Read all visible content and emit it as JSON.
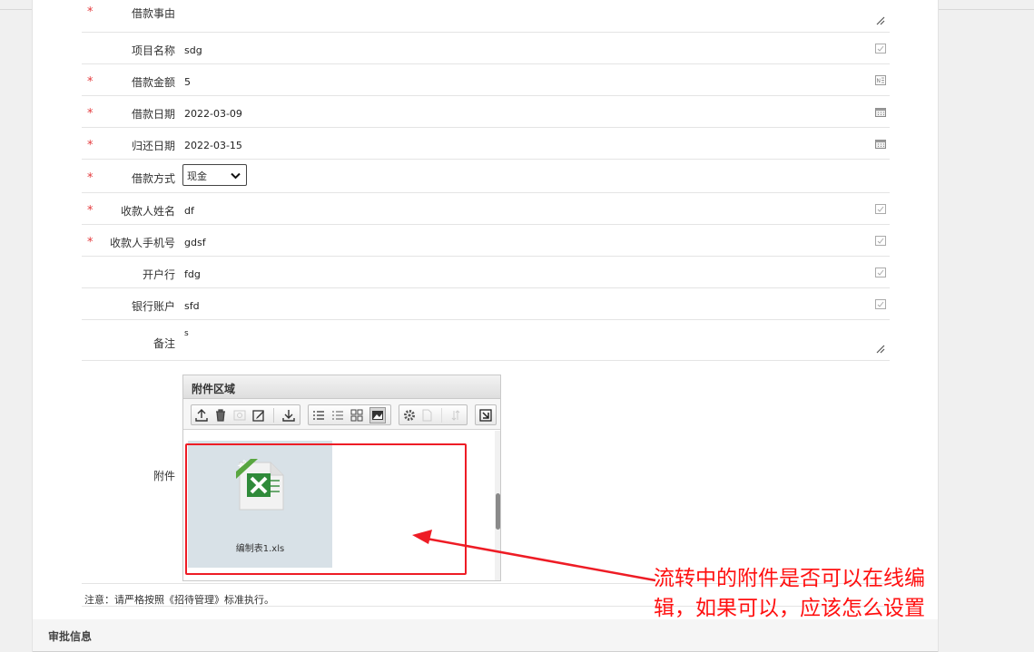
{
  "form": {
    "rows": [
      {
        "label": "借款事由",
        "required": true,
        "value": "",
        "icon": "resize-handle-icon"
      },
      {
        "label": "项目名称",
        "required": false,
        "value": "sdg",
        "icon": "edit-check-icon"
      },
      {
        "label": "借款金额",
        "required": true,
        "value": "5",
        "icon": "number-icon"
      },
      {
        "label": "借款日期",
        "required": true,
        "value": "2022-03-09",
        "icon": "calendar-icon"
      },
      {
        "label": "归还日期",
        "required": true,
        "value": "2022-03-15",
        "icon": "calendar-icon"
      },
      {
        "label": "借款方式",
        "required": true,
        "value": "现金",
        "icon": "chevron-down-icon"
      },
      {
        "label": "收款人姓名",
        "required": true,
        "value": "df",
        "icon": "edit-check-icon"
      },
      {
        "label": "收款人手机号",
        "required": true,
        "value": "gdsf",
        "icon": "edit-check-icon"
      },
      {
        "label": "开户行",
        "required": false,
        "value": "fdg",
        "icon": "edit-check-icon"
      },
      {
        "label": "银行账户",
        "required": false,
        "value": "sfd",
        "icon": "edit-check-icon"
      },
      {
        "label": "备注",
        "required": false,
        "value": "s",
        "icon": "resize-handle-icon"
      }
    ],
    "required_mark": "*"
  },
  "attachments": {
    "label": "附件",
    "panel_title": "附件区域",
    "files": [
      {
        "name": "编制表1.xls",
        "badge": "XLS",
        "icon": "excel-file-icon"
      }
    ]
  },
  "note": "注意：请严格按照《招待管理》标准执行。",
  "section_title": "审批信息",
  "annotation": {
    "line1": "流转中的附件是否可以在线编",
    "line2": "辑，如果可以，应该怎么设置",
    "color": "#ff1010"
  }
}
